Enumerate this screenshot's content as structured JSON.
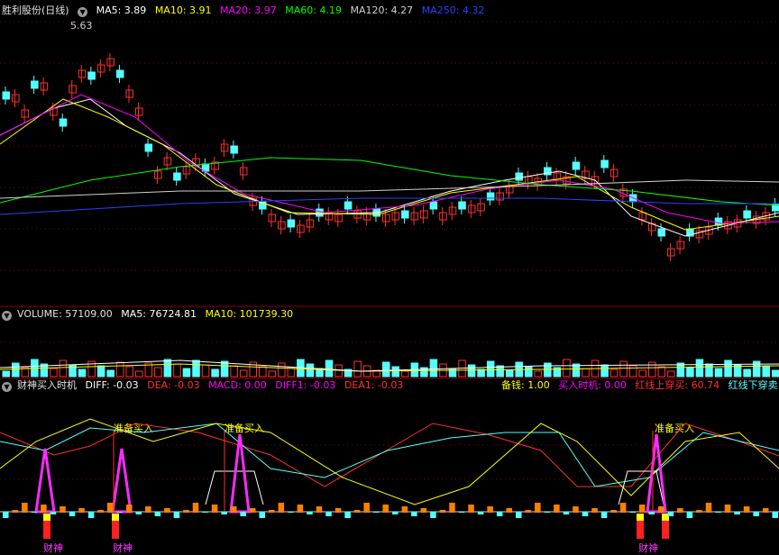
{
  "price_panel": {
    "title": "胜利股份(日线)",
    "ma5": "MA5: 3.89",
    "ma10": "MA10: 3.91",
    "ma20": "MA20: 3.97",
    "ma60": "MA60: 4.19",
    "ma120": "MA120: 4.27",
    "ma250": "MA250: 4.32",
    "high_label": "5.63",
    "colors": {
      "ma5": "#ffffff",
      "ma10": "#ffff00",
      "ma20": "#ff00ff",
      "ma60": "#00ff00",
      "ma120": "#cfcfcf",
      "ma250": "#2a40ff",
      "up": "#ff3030",
      "down": "#54ffff"
    }
  },
  "volume_panel": {
    "volume": "VOLUME: 57109.00",
    "ma5": "MA5: 76724.81",
    "ma10": "MA10: 101739.30"
  },
  "indicator_panel": {
    "title": "财神买入时机",
    "diff": "DIFF: -0.03",
    "dea": "DEA: -0.03",
    "macd": "MACD: 0.00",
    "diff1": "DIFF1: -0.03",
    "dea1": "DEA1: -0.03",
    "beiqian": "备钱: 1.00",
    "buy_timing": "买入时机: 0.00",
    "red_up": "红线上穿买: 60.74",
    "red_down": "红线下穿卖",
    "signal_labels": [
      "准备买入",
      "准备买入",
      "准备买入"
    ],
    "caishen_labels": [
      "财神",
      "财神",
      "财神"
    ]
  }
}
